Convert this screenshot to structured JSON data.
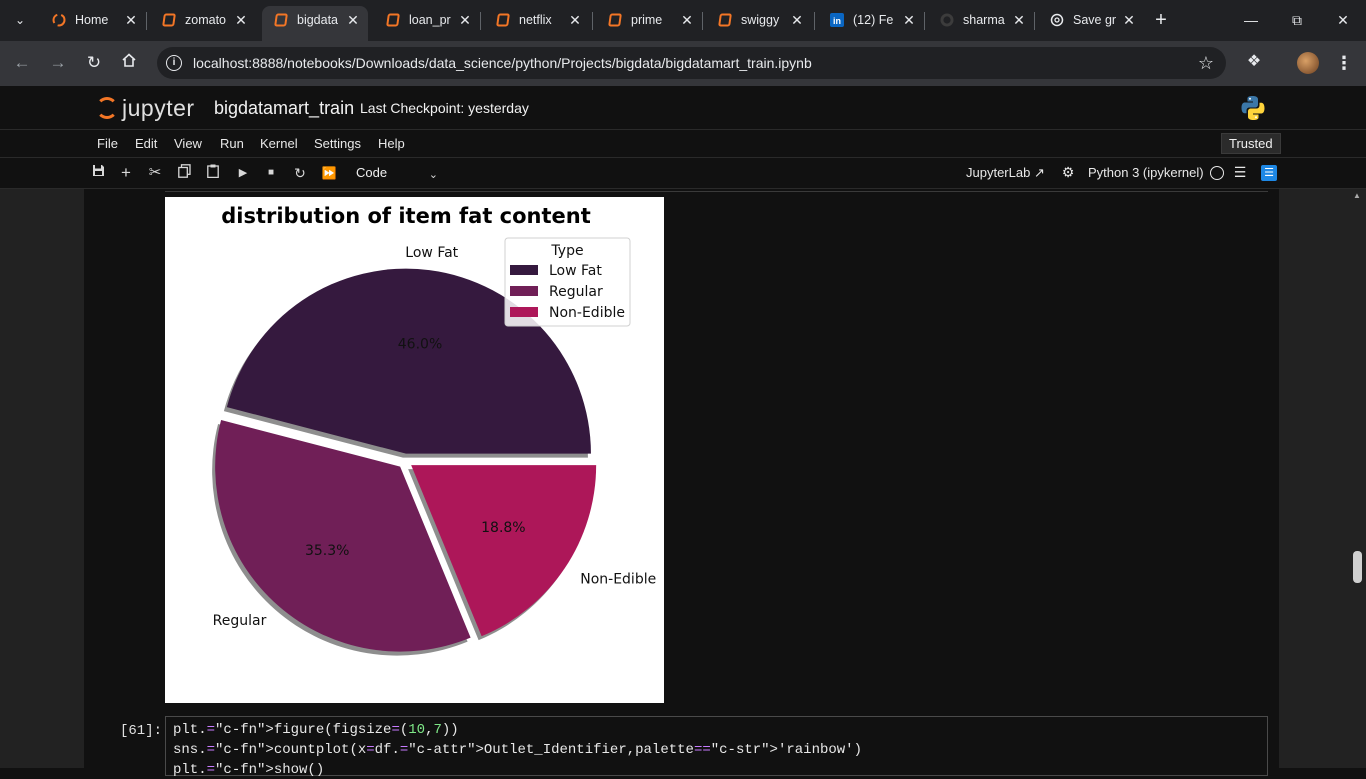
{
  "browser": {
    "tabs": [
      {
        "label": "Home",
        "icon": "jupyter-icon",
        "icon_color": "#f37626"
      },
      {
        "label": "zomato",
        "icon": "notebook-icon",
        "icon_color": "#f37626"
      },
      {
        "label": "bigdata",
        "icon": "notebook-icon",
        "icon_color": "#f37626",
        "active": true
      },
      {
        "label": "loan_pr",
        "icon": "notebook-icon",
        "icon_color": "#f37626"
      },
      {
        "label": "netflix",
        "icon": "notebook-icon",
        "icon_color": "#f37626"
      },
      {
        "label": "prime",
        "icon": "notebook-icon",
        "icon_color": "#f37626"
      },
      {
        "label": "swiggy",
        "icon": "notebook-icon",
        "icon_color": "#f37626"
      },
      {
        "label": "(12) Fe",
        "icon": "linkedin-icon",
        "icon_color": "#0a66c2"
      },
      {
        "label": "sharma",
        "icon": "github-icon",
        "icon_color": "#e8eaed"
      },
      {
        "label": "Save gr",
        "icon": "chatgpt-icon",
        "icon_color": "#e8eaed"
      }
    ],
    "url": "localhost:8888/notebooks/Downloads/data_science/python/Projects/bigdata/bigdatamart_train.ipynb"
  },
  "jupyter": {
    "logo_text": "jupyter",
    "notebook_name": "bigdatamart_train",
    "checkpoint": "Last Checkpoint: yesterday",
    "menu": [
      "File",
      "Edit",
      "View",
      "Run",
      "Kernel",
      "Settings",
      "Help"
    ],
    "trusted": "Trusted",
    "cell_type": "Code",
    "jupyterlab_link": "JupyterLab",
    "kernel_name": "Python 3 (ipykernel)"
  },
  "cell": {
    "prompt": "[61]:",
    "code_lines": [
      "plt.figure(figsize=(10,7))",
      "sns.countplot(x=df.Outlet_Identifier,palette='rainbow')",
      "plt.show()"
    ]
  },
  "chart_data": {
    "type": "pie",
    "title": "distribution of item fat content",
    "categories": [
      "Low Fat",
      "Regular",
      "Non-Edible"
    ],
    "values": [
      46.0,
      35.3,
      18.8
    ],
    "value_labels": [
      "46.0%",
      "35.3%",
      "18.8%"
    ],
    "colors": [
      "#35193e",
      "#701f57",
      "#ad1759"
    ],
    "explode": true,
    "shadow": true,
    "legend": {
      "title": "Type",
      "position": "upper-right",
      "entries": [
        "Low Fat",
        "Regular",
        "Non-Edible"
      ]
    }
  }
}
